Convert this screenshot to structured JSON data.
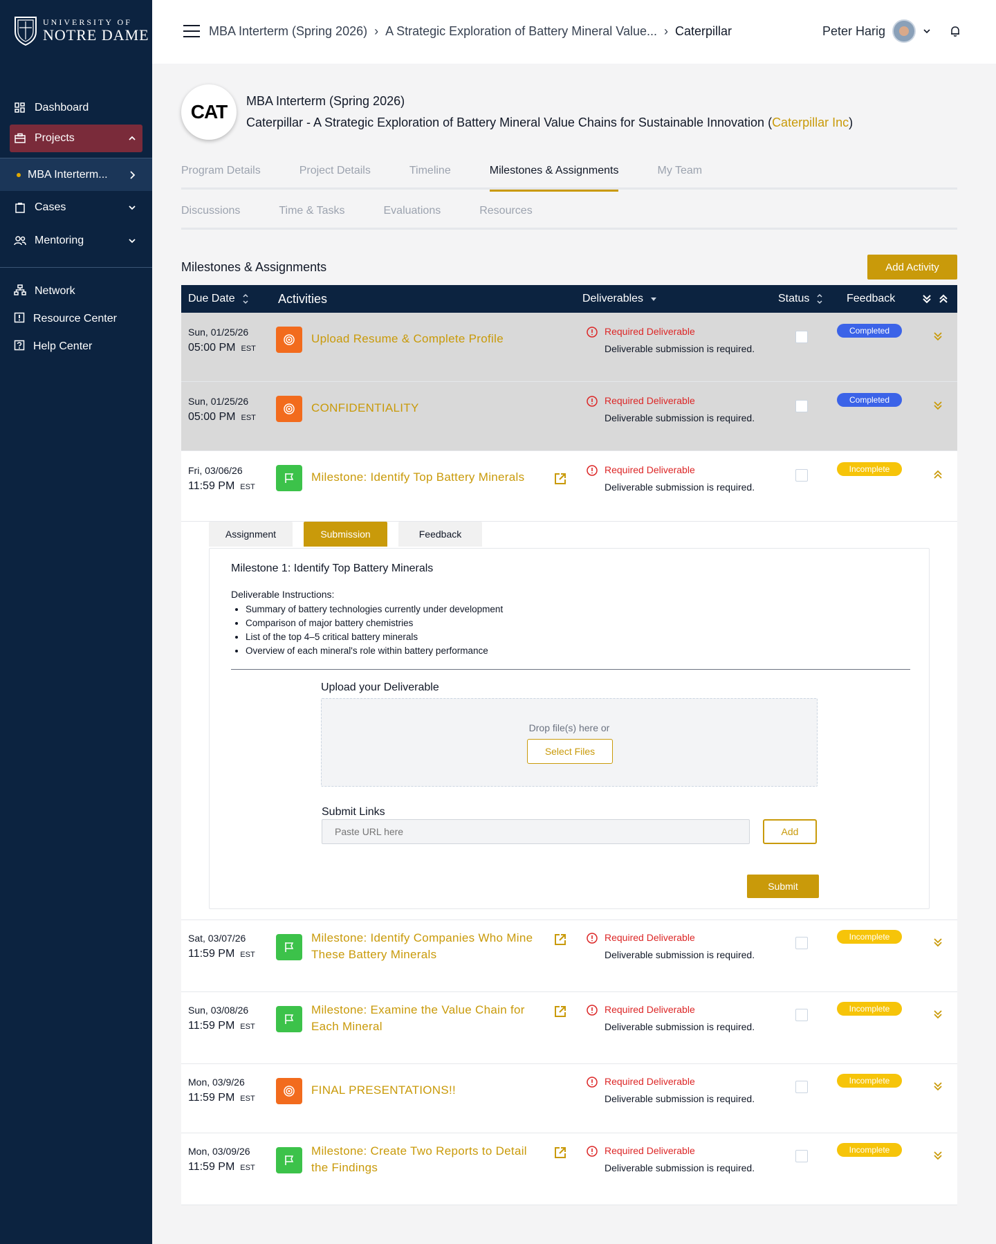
{
  "brand": {
    "top": "UNIVERSITY OF",
    "bottom": "NOTRE DAME"
  },
  "sidebar": {
    "dashboard": "Dashboard",
    "projects": "Projects",
    "sub_item": "MBA Interterm...",
    "cases": "Cases",
    "mentoring": "Mentoring",
    "network": "Network",
    "resource_center": "Resource Center",
    "help_center": "Help Center"
  },
  "header": {
    "crumb1": "MBA Interterm (Spring 2026)",
    "crumb2": "A Strategic Exploration of Battery Mineral Value...",
    "crumb3": "Caterpillar",
    "user_name": "Peter Harig"
  },
  "project": {
    "program": "MBA Interterm (Spring 2026)",
    "title": "Caterpillar - A Strategic Exploration of Battery Mineral Value Chains for Sustainable Innovation (",
    "org": "Caterpillar Inc",
    "close_paren": ")",
    "logo_text": "CAT"
  },
  "tabs": [
    "Program Details",
    "Project Details",
    "Timeline",
    "Milestones & Assignments",
    "My Team"
  ],
  "tabs2": [
    "Discussions",
    "Time & Tasks",
    "Evaluations",
    "Resources"
  ],
  "section": {
    "title": "Milestones & Assignments",
    "add_activity": "Add Activity"
  },
  "table_head": {
    "due_date": "Due Date",
    "activities": "Activities",
    "deliverables": "Deliverables",
    "status": "Status",
    "feedback": "Feedback"
  },
  "rows": [
    {
      "day": "Sun, 01/25/26",
      "time": "05:00 PM",
      "tz": "EST",
      "title": "Upload Resume & Complete Profile",
      "title2": "",
      "req": "Required Deliverable",
      "req_text": "Deliverable submission is required.",
      "badge": "Completed"
    },
    {
      "day": "Sun, 01/25/26",
      "time": "05:00 PM",
      "tz": "EST",
      "title": "CONFIDENTIALITY",
      "title2": "",
      "req": "Required Deliverable",
      "req_text": "Deliverable submission is required.",
      "badge": "Completed"
    },
    {
      "day": "Fri, 03/06/26",
      "time": "11:59 PM",
      "tz": "EST",
      "title": "Milestone: Identify Top Battery Minerals",
      "title2": "",
      "req": "Required Deliverable",
      "req_text": "Deliverable submission is required.",
      "badge": "Incomplete"
    },
    {
      "day": "Sat, 03/07/26",
      "time": "11:59 PM",
      "tz": "EST",
      "title": "Milestone: Identify Companies Who Mine",
      "title2": "These Battery Minerals",
      "req": "Required Deliverable",
      "req_text": "Deliverable submission is required.",
      "badge": "Incomplete"
    },
    {
      "day": "Sun, 03/08/26",
      "time": "11:59 PM",
      "tz": "EST",
      "title": "Milestone: Examine the Value Chain for",
      "title2": "Each Mineral",
      "req": "Required Deliverable",
      "req_text": "Deliverable submission is required.",
      "badge": "Incomplete"
    },
    {
      "day": "Mon, 03/9/26",
      "time": "11:59 PM",
      "tz": "EST",
      "title": "FINAL PRESENTATIONS!!",
      "title2": "",
      "req": "Required Deliverable",
      "req_text": "Deliverable submission is required.",
      "badge": "Incomplete"
    },
    {
      "day": "Mon, 03/09/26",
      "time": "11:59 PM",
      "tz": "EST",
      "title": "Milestone: Create Two Reports to Detail",
      "title2": "the Findings",
      "req": "Required Deliverable",
      "req_text": "Deliverable submission is required.",
      "badge": "Incomplete"
    }
  ],
  "expanded": {
    "tabs": [
      "Assignment",
      "Submission",
      "Feedback"
    ],
    "title": "Milestone 1: Identify Top Battery Minerals",
    "instr_label": "Deliverable Instructions:",
    "instructions": [
      "Summary of battery technologies currently under development",
      "Comparison of major battery chemistries",
      "List of the top 4–5 critical battery minerals",
      "Overview of each mineral's role within battery performance"
    ],
    "upload_label": "Upload your Deliverable",
    "drop_text": "Drop file(s) here or",
    "select_files": "Select Files",
    "links_label": "Submit Links",
    "url_placeholder": "Paste URL here",
    "add": "Add",
    "submit": "Submit"
  },
  "colors": {
    "navy": "#0c2340",
    "gold": "#c99a0a",
    "completed": "#3b63e8",
    "incomplete": "#f6c409",
    "required": "#dc2626"
  }
}
